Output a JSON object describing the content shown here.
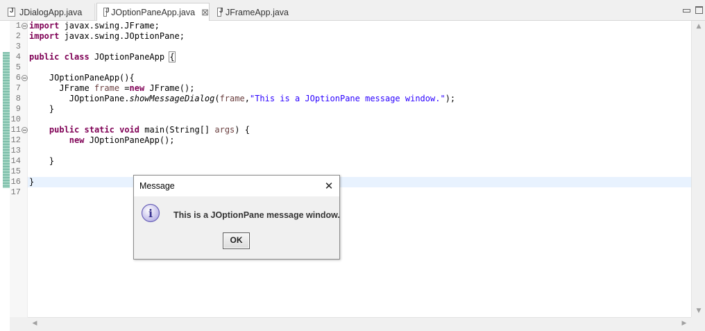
{
  "tabs": [
    {
      "label": "JDialogApp.java"
    },
    {
      "label": "JOptionPaneApp.java"
    },
    {
      "label": "JFrameApp.java"
    }
  ],
  "editor": {
    "line_numbers": [
      "1",
      "2",
      "3",
      "4",
      "5",
      "6",
      "7",
      "8",
      "9",
      "10",
      "11",
      "12",
      "13",
      "14",
      "15",
      "16",
      "17"
    ],
    "code": {
      "l1": {
        "kw": "import",
        "rest": " javax.swing.JFrame;"
      },
      "l2": {
        "kw": "import",
        "rest": " javax.swing.JOptionPane;"
      },
      "l4": {
        "kw1": "public",
        "kw2": "class",
        "name": " JOptionPaneApp ",
        "brace": "{"
      },
      "l6": {
        "text": "    JOptionPaneApp(){"
      },
      "l7": {
        "indent": "      JFrame ",
        "field": "frame",
        "eq": " =",
        "kw": "new",
        "rest": " JFrame();"
      },
      "l8": {
        "indent": "        JOptionPane.",
        "method": "showMessageDialog",
        "open": "(",
        "field": "frame",
        "comma": ",",
        "str": "\"This is a JOptionPane message window.\"",
        "close": ");"
      },
      "l9": {
        "text": "    }"
      },
      "l11": {
        "kw1": "public",
        "kw2": "static",
        "kw3": "void",
        "mid": " main(String[] ",
        "field": "args",
        "end": ") {"
      },
      "l12": {
        "kw": "new",
        "rest": " JOptionPaneApp();"
      },
      "l14": {
        "text": "    }"
      },
      "l16": {
        "text": "}"
      }
    }
  },
  "dialog": {
    "title": "Message",
    "close_glyph": "✕",
    "icon": "info-icon",
    "icon_letter": "i",
    "message": "This is a JOptionPane message window.",
    "ok_label": "OK"
  },
  "colors": {
    "keyword": "#7f0055",
    "string": "#2a00ff",
    "field": "#6a3e3e",
    "current_line": "#e8f2fe"
  }
}
